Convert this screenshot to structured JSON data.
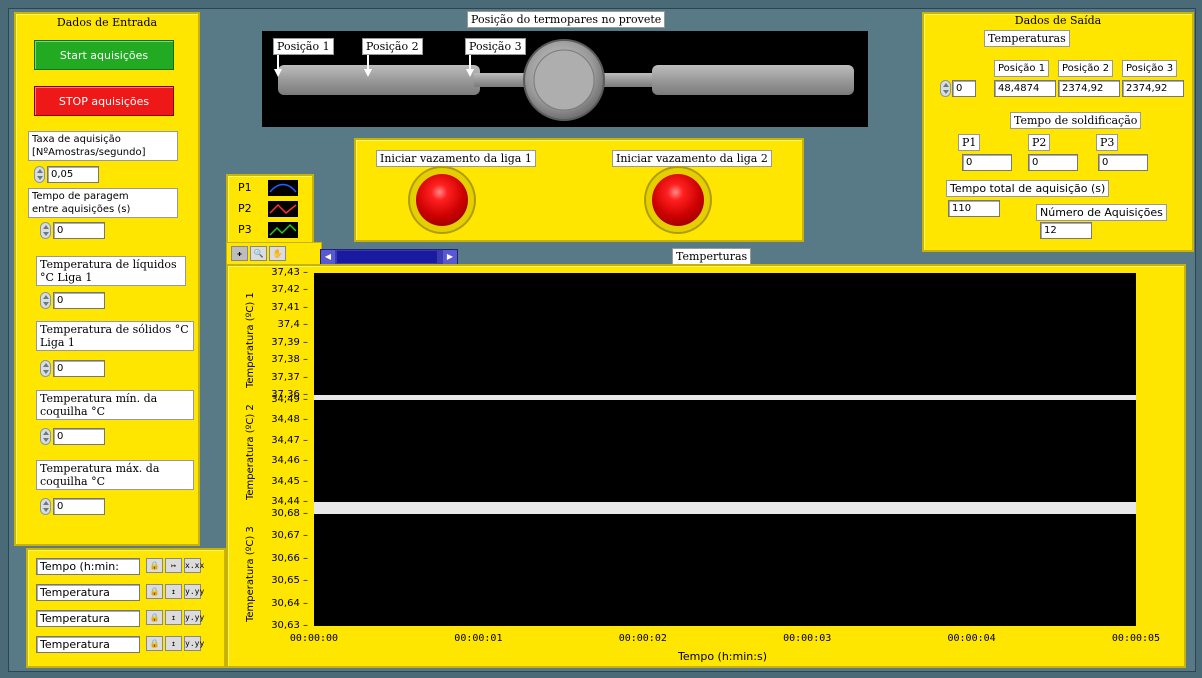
{
  "input_panel": {
    "title": "Dados de Entrada",
    "start_label": "Start aquisições",
    "stop_label": "STOP aquisições",
    "sample_rate_label": "Taxa de aquisição\n[NºAmostras/segundo]",
    "sample_rate_value": "0,05",
    "pause_label": "Tempo de paragem\nentre aquisições (s)",
    "pause_value": "0",
    "liquidus_label": "Temperatura de líquidos\n°C Liga 1",
    "liquidus_value": "0",
    "solidus_label": "Temperatura de sólidos  °C\nLiga 1",
    "solidus_value": "0",
    "mold_min_label": "Temperatura mín. da\ncoquilha °C",
    "mold_min_value": "0",
    "mold_max_label": "Temperatura máx. da\ncoquilha °C",
    "mold_max_value": "0"
  },
  "specimen": {
    "title": "Posição do termopares no provete",
    "positions": [
      "Posição 1",
      "Posição 2",
      "Posição 3"
    ]
  },
  "pour": {
    "alloy1_label": "Iniciar vazamento da liga 1",
    "alloy2_label": "Iniciar vazamento da liga 2"
  },
  "output_panel": {
    "title": "Dados de Saída",
    "temps_title": "Temperaturas",
    "index_value": "0",
    "headers": [
      "Posição 1",
      "Posição 2",
      "Posição 3"
    ],
    "temps_values": [
      "48,4874",
      "2374,92",
      "2374,92"
    ],
    "solid_title": "Tempo de soldificação",
    "solid_headers": [
      "P1",
      "P2",
      "P3"
    ],
    "solid_values": [
      "0",
      "0",
      "0"
    ],
    "total_time_label": "Tempo total de aquisição (s)",
    "total_time_value": "110",
    "n_acq_label": "Número de Aquisições",
    "n_acq_value": "12"
  },
  "legend": {
    "items": [
      "P1",
      "P2",
      "P3"
    ],
    "colors": [
      "#2060ff",
      "#ff3030",
      "#20d020"
    ]
  },
  "scale_legend": {
    "rows": [
      "Tempo (h:min:",
      "Temperatura",
      "Temperatura",
      "Temperatura"
    ],
    "icon1": "🔒",
    "fmt_x": "x.xx",
    "fmt_y": "y.yy"
  },
  "chart_title": "Temperturas",
  "chart_data": [
    {
      "type": "line",
      "ylabel": "Temperatura (ºC) 1",
      "yticks": [
        "37,43",
        "37,42",
        "37,41",
        "37,4",
        "37,39",
        "37,38",
        "37,37",
        "37,36"
      ],
      "ylim": [
        37.36,
        37.43
      ],
      "series": []
    },
    {
      "type": "line",
      "ylabel": "Temperatura (ºC) 2",
      "yticks": [
        "34,49",
        "34,48",
        "34,47",
        "34,46",
        "34,45",
        "34,44"
      ],
      "ylim": [
        34.44,
        34.49
      ],
      "series": []
    },
    {
      "type": "line",
      "ylabel": "Temperatura (ºC) 3",
      "yticks": [
        "30,68",
        "30,67",
        "30,66",
        "30,65",
        "30,64",
        "30,63"
      ],
      "ylim": [
        30.63,
        30.68
      ],
      "xlabel": "Tempo (h:min:s)",
      "xticks": [
        "00:00:00",
        "00:00:01",
        "00:00:02",
        "00:00:03",
        "00:00:04",
        "00:00:05"
      ],
      "series": []
    }
  ]
}
